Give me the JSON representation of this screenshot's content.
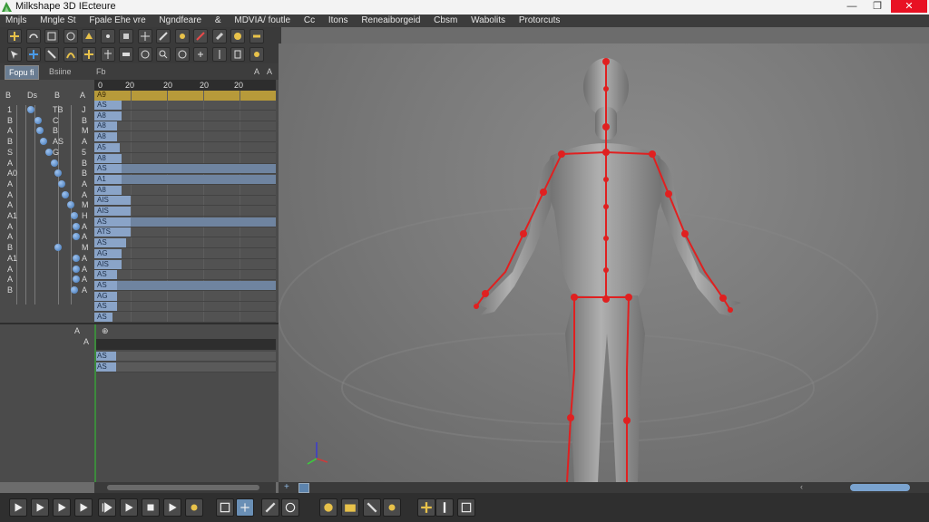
{
  "window": {
    "title": "Milkshape 3D IEcteure",
    "minimize": "—",
    "maximize": "❐",
    "close": "✕"
  },
  "menu": [
    "Mnjls",
    "Mngle St",
    "Fpale Ehe vre",
    "Ngndfeare",
    "&",
    "MDVIA/ foutle",
    "Cc",
    "Itons",
    "Reneaiborgeid",
    "Cbsm",
    "Wabolits",
    "Protorcuts"
  ],
  "toolbar1_icons": [
    "move-icon",
    "rotate-icon",
    "scale-icon",
    "select-icon",
    "lasso-icon",
    "vertex-icon",
    "face-icon",
    "group-icon",
    "bone-icon",
    "joint-icon",
    "knife-icon",
    "brush-icon",
    "paint-icon",
    "weld-icon"
  ],
  "toolbar2_icons": [
    "pointer-icon",
    "move-arrows-icon",
    "arrow-icon",
    "bend-icon",
    "cross-icon",
    "tree-icon",
    "plane-icon",
    "sphere-icon",
    "zoom-icon",
    "camera-icon",
    "rig-icon",
    "mirror-icon",
    "cylinder-icon",
    "light-icon"
  ],
  "panel": {
    "tabs": [
      "Fopu fi",
      "Bsiine",
      "Fb"
    ],
    "marks": [
      "A",
      "A"
    ]
  },
  "tree": {
    "headers": [
      "B",
      "Ds",
      "B",
      "A"
    ],
    "rows": [
      [
        "1",
        "",
        "TB",
        "J"
      ],
      [
        "B",
        "",
        "C",
        "B"
      ],
      [
        "A",
        "",
        "B",
        "M"
      ],
      [
        "B",
        "",
        "AS",
        "A"
      ],
      [
        "S",
        "",
        "G",
        "5"
      ],
      [
        "A",
        "",
        "",
        "B"
      ],
      [
        "A0",
        "",
        "",
        "B"
      ],
      [
        "A",
        "",
        "",
        "A"
      ],
      [
        "A",
        "",
        "",
        "A"
      ],
      [
        "A",
        "",
        "",
        "M"
      ],
      [
        "A1",
        "",
        "",
        "H"
      ],
      [
        "A",
        "",
        "",
        "A"
      ],
      [
        "A",
        "",
        "",
        "A"
      ],
      [
        "B",
        "",
        "",
        "M"
      ],
      [
        "A1",
        "",
        "",
        "A"
      ],
      [
        "A",
        "",
        "",
        "A"
      ],
      [
        "A",
        "",
        "",
        "A"
      ],
      [
        "B",
        "",
        "",
        "A"
      ]
    ]
  },
  "grid": {
    "header": [
      "0",
      "20",
      "20",
      "20",
      "20"
    ],
    "selected_label": "A9",
    "rows": [
      {
        "label": "AS",
        "length": 30
      },
      {
        "label": "A8",
        "length": 30
      },
      {
        "label": "A8",
        "length": 25
      },
      {
        "label": "A8",
        "length": 25
      },
      {
        "label": "A5",
        "length": 28
      },
      {
        "label": "A8",
        "length": 30
      },
      {
        "label": "AS",
        "length": 30
      },
      {
        "label": "A1",
        "length": 30
      },
      {
        "label": "A8",
        "length": 30
      },
      {
        "label": "AIS",
        "length": 40
      },
      {
        "label": "AIS",
        "length": 40
      },
      {
        "label": "AS",
        "length": 40
      },
      {
        "label": "ATS",
        "length": 40
      },
      {
        "label": "AS",
        "length": 35
      },
      {
        "label": "AG",
        "length": 30
      },
      {
        "label": "AIS",
        "length": 30
      },
      {
        "label": "AS",
        "length": 25
      },
      {
        "label": "AS",
        "length": 25
      },
      {
        "label": "AG",
        "length": 25
      },
      {
        "label": "AS",
        "length": 25
      },
      {
        "label": "AS",
        "length": 20
      }
    ],
    "highlighted_rows": [
      6,
      7,
      11,
      17
    ]
  },
  "lower": {
    "left_labels": [
      "A",
      "A"
    ],
    "mark": "⊕",
    "rows": [
      "AS",
      "AS"
    ]
  },
  "bottom_toolbar": [
    "play-icon",
    "play-icon",
    "play-icon",
    "play-icon",
    "skip-icon",
    "play-icon",
    "stop-icon",
    "play-icon",
    "joint-icon",
    "keyframe-icon",
    "bind-icon",
    "bone-icon",
    "refresh-icon",
    "paint-icon",
    "folder-icon",
    "arrow-icon",
    "light-icon",
    "move-icon",
    "pin-icon",
    "grid-icon"
  ],
  "colors": {
    "bone": "#e02020",
    "skin": "#9a9a9a",
    "accent": "#6a8fb5"
  }
}
